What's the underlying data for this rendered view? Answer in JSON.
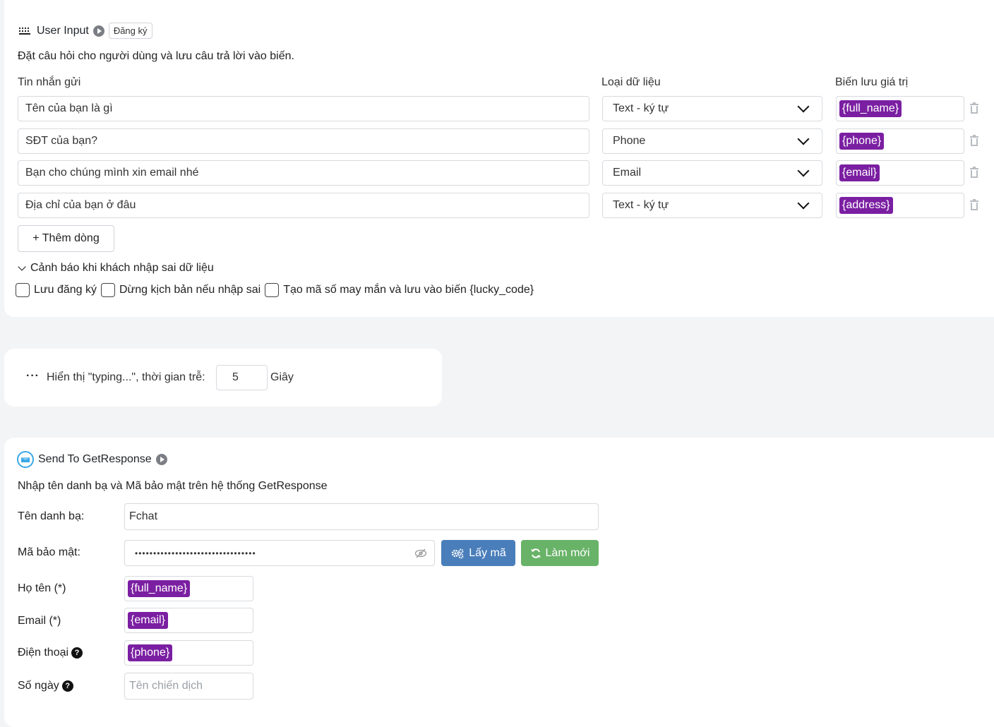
{
  "user_input": {
    "title": "User Input",
    "tag": "Đăng ký",
    "description": "Đặt câu hỏi cho người dùng và lưu câu trả lời vào biến.",
    "col_message": "Tin nhắn gửi",
    "col_type": "Loại dữ liệu",
    "col_var": "Biến lưu giá trị",
    "rows": [
      {
        "message": "Tên của bạn là gì",
        "type": "Text - ký tự",
        "var": "{full_name}"
      },
      {
        "message": "SĐT của bạn?",
        "type": "Phone",
        "var": "{phone}"
      },
      {
        "message": "Bạn cho chúng mình xin email nhé",
        "type": "Email",
        "var": "{email}"
      },
      {
        "message": "Địa chỉ của bạn ở đâu",
        "type": "Text - ký tự",
        "var": "{address}"
      }
    ],
    "add_row": "+ Thêm dòng",
    "warning_toggle": "Cảnh báo khi khách nhập sai dữ liệu",
    "checkboxes": [
      {
        "label": "Lưu đăng ký",
        "checked": false
      },
      {
        "label": "Dừng kịch bản nếu nhập sai",
        "checked": false
      },
      {
        "label": "Tạo mã số may mắn và lưu vào biến {lucky_code}",
        "checked": false
      }
    ]
  },
  "typing": {
    "label": "Hiển thị \"typing...\", thời gian trễ:",
    "value": "5",
    "unit": "Giây"
  },
  "getresponse": {
    "title": "Send To GetResponse",
    "description": "Nhập tên danh bạ và Mã bảo mật trên hệ thống GetResponse",
    "contact_label": "Tên danh bạ:",
    "contact_value": "Fchat",
    "key_label": "Mã bảo mật:",
    "key_value": "•••••••••••••••••••••••••••••••••",
    "get_key_button": "Lấy mã",
    "refresh_button": "Làm mới",
    "fields": [
      {
        "label": "Họ tên (*)",
        "var": "{full_name}",
        "help": false
      },
      {
        "label": "Email (*)",
        "var": "{email}",
        "help": false
      },
      {
        "label": "Điện thoại",
        "var": "{phone}",
        "help": true
      }
    ],
    "days_label": "Số ngày",
    "days_placeholder": "Tên chiến dịch"
  },
  "colors": {
    "variable_chip": "#7b1fa2",
    "primary_button": "#4a7ebb",
    "success_button": "#69b368"
  }
}
